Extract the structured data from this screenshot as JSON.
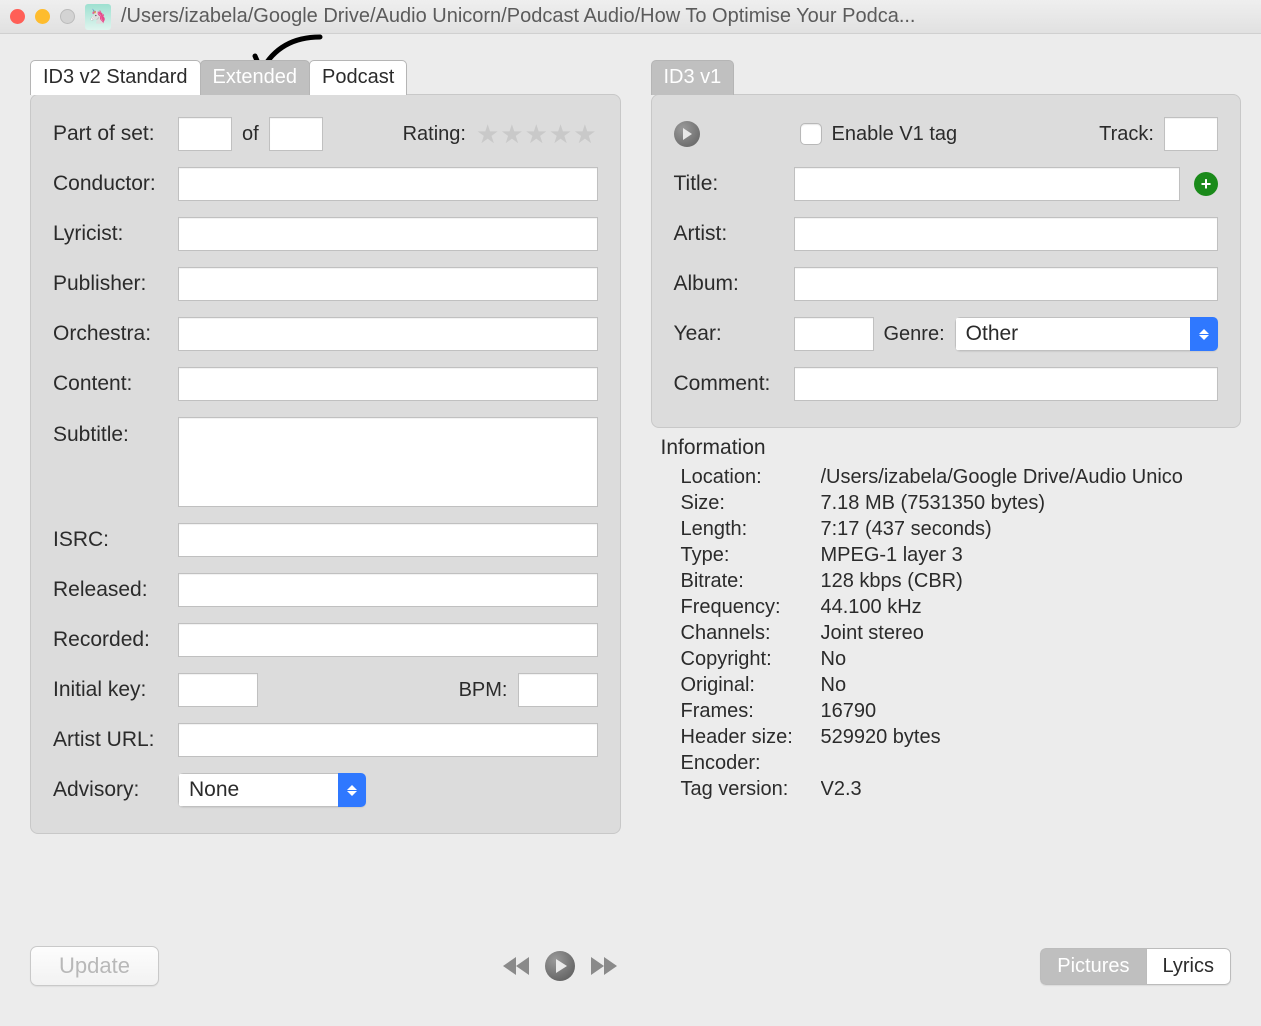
{
  "window": {
    "title": "/Users/izabela/Google Drive/Audio Unicorn/Podcast Audio/How To Optimise Your Podca..."
  },
  "left_tabs": {
    "items": [
      "ID3 v2 Standard",
      "Extended",
      "Podcast"
    ],
    "active_index": 1
  },
  "extended": {
    "part_of_set_label": "Part of set:",
    "part_of_set_a": "",
    "of_label": "of",
    "part_of_set_b": "",
    "rating_label": "Rating:",
    "conductor_label": "Conductor:",
    "conductor": "",
    "lyricist_label": "Lyricist:",
    "lyricist": "",
    "publisher_label": "Publisher:",
    "publisher": "",
    "orchestra_label": "Orchestra:",
    "orchestra": "",
    "content_label": "Content:",
    "content": "",
    "subtitle_label": "Subtitle:",
    "subtitle": "",
    "isrc_label": "ISRC:",
    "isrc": "",
    "released_label": "Released:",
    "released": "",
    "recorded_label": "Recorded:",
    "recorded": "",
    "initial_key_label": "Initial key:",
    "initial_key": "",
    "bpm_label": "BPM:",
    "bpm": "",
    "artist_url_label": "Artist URL:",
    "artist_url": "",
    "advisory_label": "Advisory:",
    "advisory_value": "None"
  },
  "right_tab": {
    "label": "ID3 v1"
  },
  "v1": {
    "enable_label": "Enable V1 tag",
    "enable_checked": false,
    "track_label": "Track:",
    "track": "",
    "title_label": "Title:",
    "title": "",
    "artist_label": "Artist:",
    "artist": "",
    "album_label": "Album:",
    "album": "",
    "year_label": "Year:",
    "year": "",
    "genre_label": "Genre:",
    "genre_value": "Other",
    "comment_label": "Comment:",
    "comment": ""
  },
  "info": {
    "heading": "Information",
    "rows": [
      {
        "k": "Location:",
        "v": "/Users/izabela/Google Drive/Audio Unico"
      },
      {
        "k": "Size:",
        "v": "7.18 MB (7531350 bytes)"
      },
      {
        "k": "Length:",
        "v": "7:17 (437 seconds)"
      },
      {
        "k": "Type:",
        "v": "MPEG-1 layer 3"
      },
      {
        "k": "Bitrate:",
        "v": "128 kbps (CBR)"
      },
      {
        "k": "Frequency:",
        "v": "44.100 kHz"
      },
      {
        "k": "Channels:",
        "v": "Joint stereo"
      },
      {
        "k": "Copyright:",
        "v": "No"
      },
      {
        "k": "Original:",
        "v": "No"
      },
      {
        "k": "Frames:",
        "v": "16790"
      },
      {
        "k": "Header size:",
        "v": "529920 bytes"
      },
      {
        "k": "Encoder:",
        "v": ""
      },
      {
        "k": "Tag version:",
        "v": "V2.3"
      }
    ]
  },
  "footer": {
    "update_label": "Update",
    "pictures_label": "Pictures",
    "lyrics_label": "Lyrics"
  }
}
